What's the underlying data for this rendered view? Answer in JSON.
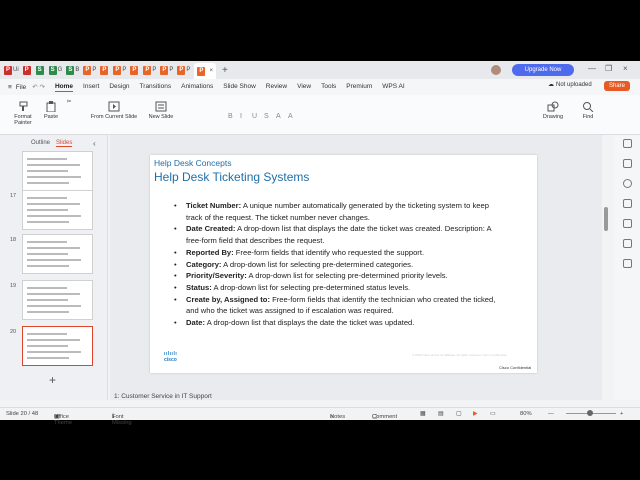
{
  "tabs": [
    {
      "label": "Ui",
      "color": "#c9302c",
      "glyph": "P"
    },
    {
      "label": "",
      "color": "#c9302c",
      "glyph": "P"
    },
    {
      "label": "",
      "color": "#2e8b4e",
      "glyph": "S"
    },
    {
      "label": "G",
      "color": "#2e8b4e",
      "glyph": "S"
    },
    {
      "label": "B",
      "color": "#2e8b4e",
      "glyph": "S"
    },
    {
      "label": "P",
      "color": "#e8652a",
      "glyph": "P"
    },
    {
      "label": "",
      "color": "#e8652a",
      "glyph": "P"
    },
    {
      "label": "P",
      "color": "#e8652a",
      "glyph": "P"
    },
    {
      "label": "",
      "color": "#e8652a",
      "glyph": "P"
    },
    {
      "label": "P",
      "color": "#e8652a",
      "glyph": "P"
    },
    {
      "label": "P",
      "color": "#e8652a",
      "glyph": "P"
    },
    {
      "label": "P",
      "color": "#e8652a",
      "glyph": "P"
    }
  ],
  "active_tab": {
    "glyph": "P",
    "color": "#e8652a"
  },
  "window": {
    "upgrade": "Upgrade Now",
    "close": "×",
    "restore": "❐",
    "minimize": "—",
    "new_tab": "+"
  },
  "menu": {
    "file": "File",
    "items": [
      "Home",
      "Insert",
      "Design",
      "Transitions",
      "Animations",
      "Slide Show",
      "Review",
      "View",
      "Tools",
      "Premium",
      "WPS AI"
    ],
    "active": "Home",
    "not_uploaded": "Not uploaded",
    "share": "Share"
  },
  "ribbon": {
    "format_painter": "Format Painter",
    "paste": "Paste",
    "from_current_slide": "From Current Slide",
    "new_slide": "New Slide",
    "drawing": "Drawing",
    "find": "Find",
    "format_buttons": [
      "B",
      "I",
      "U",
      "S",
      "A",
      "A"
    ]
  },
  "side_panel": {
    "tab_outline": "Outline",
    "tab_slides": "Slides",
    "collapse": "‹",
    "thumbs": [
      {
        "num": ""
      },
      {
        "num": "17"
      },
      {
        "num": "18"
      },
      {
        "num": "19"
      },
      {
        "num": "20"
      }
    ],
    "add": "+"
  },
  "slide": {
    "subtitle": "Help Desk Concepts",
    "title": "Help Desk Ticketing Systems",
    "bullets": [
      {
        "bold": "Ticket Number:",
        "text": " A unique number automatically generated by the ticketing system to keep track of the request. The ticket number never changes."
      },
      {
        "bold": "Date Created:",
        "text": " A drop-down list that displays the date the ticket was created. Description: A free-form field that describes the request."
      },
      {
        "bold": "Reported By:",
        "text": " Free-form fields that identify who requested the support."
      },
      {
        "bold": "Category:",
        "text": " A drop-down list for selecting pre-determined categories."
      },
      {
        "bold": "Priority/Severity:",
        "text": " A drop-down list for selecting pre-determined priority levels."
      },
      {
        "bold": "Status:",
        "text": " A drop-down list for selecting pre-determined status levels."
      },
      {
        "bold": "Create by, Assigned to:",
        "text": " Free-form fields that identify the technician who created the ticked, and who the ticket was assigned to if escalation was required."
      },
      {
        "bold": "Date:",
        "text": " A drop-down list that displays the date the ticket was updated."
      }
    ],
    "logo": "cisco",
    "confidential": "Cisco Confidential",
    "footer": "© 2020 Cisco and/or its affiliates. All rights reserved. Cisco Confidential"
  },
  "notes_text": "1: Customer Service in IT Support",
  "status": {
    "slide": "Slide 20 / 48",
    "theme": "Office Theme",
    "font_missing": "Font Missing",
    "notes": "Notes",
    "comment": "Comment",
    "zoom": "80%",
    "minus": "—",
    "plus": "+"
  }
}
